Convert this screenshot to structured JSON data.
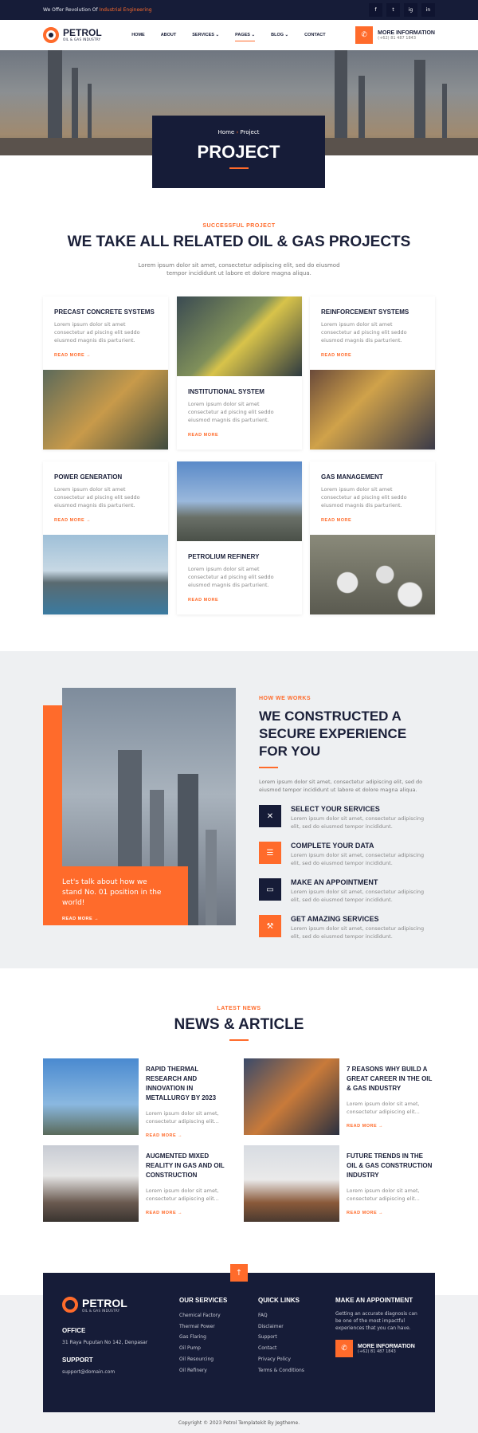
{
  "topbar": {
    "msg_prefix": "We Offer Revolution Of",
    "msg_highlight": "Industrial Engineering",
    "socials": [
      "f",
      "t",
      "ig",
      "in"
    ]
  },
  "header": {
    "logo": {
      "name": "PETROL",
      "tagline": "OIL & GAS INDUSTRY"
    },
    "nav": [
      "HOME",
      "ABOUT",
      "SERVICES",
      "PAGES",
      "BLOG",
      "CONTACT"
    ],
    "info_title": "MORE INFORMATION",
    "info_phone": "(+62) 81 487 1843"
  },
  "hero": {
    "breadcrumb_home": "Home",
    "breadcrumb_sep": "›",
    "breadcrumb_current": "Project",
    "title": "PROJECT"
  },
  "projects": {
    "eyebrow": "SUCCESSFUL PROJECT",
    "title": "WE TAKE ALL RELATED OIL & GAS PROJECTS",
    "lead": "Lorem ipsum dolor sit amet, consectetur adipiscing elit, sed do eiusmod tempor incididunt ut labore et dolore magna aliqua.",
    "cards": [
      {
        "title": "PRECAST CONCRETE SYSTEMS",
        "desc": "Lorem ipsum dolor sit amet consectetur ad piscing elit seddo eiusmod magnis dis parturient.",
        "more": "READ MORE →"
      },
      {
        "title": "INSTITUTIONAL SYSTEM",
        "desc": "Lorem ipsum dolor sit amet consectetur ad piscing elit seddo eiusmod magnis dis parturient.",
        "more": "READ MORE"
      },
      {
        "title": "REINFORCEMENT SYSTEMS",
        "desc": "Lorem ipsum dolor sit amet consectetur ad piscing elit seddo eiusmod magnis dis parturient.",
        "more": "READ MORE"
      },
      {
        "title": "POWER GENERATION",
        "desc": "Lorem ipsum dolor sit amet consectetur ad piscing elit seddo eiusmod magnis dis parturient.",
        "more": "READ MORE →"
      },
      {
        "title": "PETROLIUM REFINERY",
        "desc": "Lorem ipsum dolor sit amet consectetur ad piscing elit seddo eiusmod magnis dis parturient.",
        "more": "READ MORE"
      },
      {
        "title": "GAS MANAGEMENT",
        "desc": "Lorem ipsum dolor sit amet consectetur ad piscing elit seddo eiusmod magnis dis parturient.",
        "more": "READ MORE"
      }
    ]
  },
  "how": {
    "eyebrow": "HOW WE WORKS",
    "title": "WE CONSTRUCTED A SECURE EXPERIENCE FOR YOU",
    "lead": "Lorem ipsum dolor sit amet, consectetur adipiscing elit, sed do eiusmod tempor incididunt ut labore et dolore magna aliqua.",
    "box_text": "Let's talk about how we stand No. 01 position in the world!",
    "box_more": "READ MORE →",
    "steps": [
      {
        "title": "SELECT YOUR SERVICES",
        "desc": "Lorem ipsum dolor sit amet, consectetur adipiscing elit, sed do eiusmod tempor incididunt."
      },
      {
        "title": "COMPLETE YOUR DATA",
        "desc": "Lorem ipsum dolor sit amet, consectetur adipiscing elit, sed do eiusmod tempor incididunt."
      },
      {
        "title": "MAKE AN APPOINTMENT",
        "desc": "Lorem ipsum dolor sit amet, consectetur adipiscing elit, sed do eiusmod tempor incididunt."
      },
      {
        "title": "GET AMAZING SERVICES",
        "desc": "Lorem ipsum dolor sit amet, consectetur adipiscing elit, sed do eiusmod tempor incididunt."
      }
    ]
  },
  "news": {
    "eyebrow": "LATEST NEWS",
    "title": "NEWS & ARTICLE",
    "items": [
      {
        "title": "RAPID THERMAL RESEARCH AND INNOVATION IN METALLURGY BY 2023",
        "desc": "Lorem ipsum dolor sit amet, consectetur adipiscing elit...",
        "more": "READ MORE →"
      },
      {
        "title": "7 REASONS WHY BUILD A GREAT CAREER IN THE OIL & GAS INDUSTRY",
        "desc": "Lorem ipsum dolor sit amet, consectetur adipiscing elit...",
        "more": "READ MORE →"
      },
      {
        "title": "AUGMENTED MIXED REALITY IN GAS AND OIL CONSTRUCTION",
        "desc": "Lorem ipsum dolor sit amet, consectetur adipiscing elit...",
        "more": "READ MORE →"
      },
      {
        "title": "FUTURE TRENDS IN THE OIL & GAS CONSTRUCTION INDUSTRY",
        "desc": "Lorem ipsum dolor sit amet, consectetur adipiscing elit...",
        "more": "READ MORE →"
      }
    ]
  },
  "footer": {
    "office_title": "OFFICE",
    "office_addr": "31 Raya Puputan No 142, Denpasar",
    "support_title": "SUPPORT",
    "support_email": "support@domain.com",
    "services_title": "OUR SERVICES",
    "services": [
      "Chemical Factory",
      "Thermal Power",
      "Gas Flaring",
      "Oil Pump",
      "Oil Resourcing",
      "Oil Refinery"
    ],
    "links_title": "QUICK LINKS",
    "links": [
      "FAQ",
      "Disclaimer",
      "Support",
      "Contact",
      "Privacy Policy",
      "Terms & Conditions"
    ],
    "appt_title": "MAKE AN APPOINTMENT",
    "appt_text": "Getting an accurate diagnosis can be one of the most impactful experiences that you can have.",
    "info_title": "MORE INFORMATION",
    "info_phone": "(+62) 81 487 1843",
    "copyright": "Copyright © 2023 Petrol Templatekit By Jegtheme."
  },
  "colors": {
    "accent": "#ff6b2b",
    "navy": "#161c38"
  }
}
